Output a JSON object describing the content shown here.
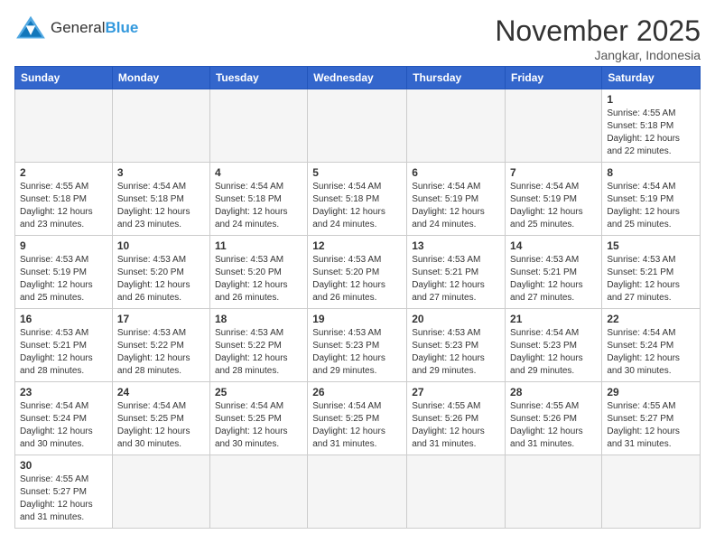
{
  "logo": {
    "text_general": "General",
    "text_blue": "Blue"
  },
  "title": "November 2025",
  "location": "Jangkar, Indonesia",
  "days_of_week": [
    "Sunday",
    "Monday",
    "Tuesday",
    "Wednesday",
    "Thursday",
    "Friday",
    "Saturday"
  ],
  "weeks": [
    [
      {
        "day": "",
        "info": ""
      },
      {
        "day": "",
        "info": ""
      },
      {
        "day": "",
        "info": ""
      },
      {
        "day": "",
        "info": ""
      },
      {
        "day": "",
        "info": ""
      },
      {
        "day": "",
        "info": ""
      },
      {
        "day": "1",
        "info": "Sunrise: 4:55 AM\nSunset: 5:18 PM\nDaylight: 12 hours and 22 minutes."
      }
    ],
    [
      {
        "day": "2",
        "info": "Sunrise: 4:55 AM\nSunset: 5:18 PM\nDaylight: 12 hours and 23 minutes."
      },
      {
        "day": "3",
        "info": "Sunrise: 4:54 AM\nSunset: 5:18 PM\nDaylight: 12 hours and 23 minutes."
      },
      {
        "day": "4",
        "info": "Sunrise: 4:54 AM\nSunset: 5:18 PM\nDaylight: 12 hours and 24 minutes."
      },
      {
        "day": "5",
        "info": "Sunrise: 4:54 AM\nSunset: 5:18 PM\nDaylight: 12 hours and 24 minutes."
      },
      {
        "day": "6",
        "info": "Sunrise: 4:54 AM\nSunset: 5:19 PM\nDaylight: 12 hours and 24 minutes."
      },
      {
        "day": "7",
        "info": "Sunrise: 4:54 AM\nSunset: 5:19 PM\nDaylight: 12 hours and 25 minutes."
      },
      {
        "day": "8",
        "info": "Sunrise: 4:54 AM\nSunset: 5:19 PM\nDaylight: 12 hours and 25 minutes."
      }
    ],
    [
      {
        "day": "9",
        "info": "Sunrise: 4:53 AM\nSunset: 5:19 PM\nDaylight: 12 hours and 25 minutes."
      },
      {
        "day": "10",
        "info": "Sunrise: 4:53 AM\nSunset: 5:20 PM\nDaylight: 12 hours and 26 minutes."
      },
      {
        "day": "11",
        "info": "Sunrise: 4:53 AM\nSunset: 5:20 PM\nDaylight: 12 hours and 26 minutes."
      },
      {
        "day": "12",
        "info": "Sunrise: 4:53 AM\nSunset: 5:20 PM\nDaylight: 12 hours and 26 minutes."
      },
      {
        "day": "13",
        "info": "Sunrise: 4:53 AM\nSunset: 5:21 PM\nDaylight: 12 hours and 27 minutes."
      },
      {
        "day": "14",
        "info": "Sunrise: 4:53 AM\nSunset: 5:21 PM\nDaylight: 12 hours and 27 minutes."
      },
      {
        "day": "15",
        "info": "Sunrise: 4:53 AM\nSunset: 5:21 PM\nDaylight: 12 hours and 27 minutes."
      }
    ],
    [
      {
        "day": "16",
        "info": "Sunrise: 4:53 AM\nSunset: 5:21 PM\nDaylight: 12 hours and 28 minutes."
      },
      {
        "day": "17",
        "info": "Sunrise: 4:53 AM\nSunset: 5:22 PM\nDaylight: 12 hours and 28 minutes."
      },
      {
        "day": "18",
        "info": "Sunrise: 4:53 AM\nSunset: 5:22 PM\nDaylight: 12 hours and 28 minutes."
      },
      {
        "day": "19",
        "info": "Sunrise: 4:53 AM\nSunset: 5:23 PM\nDaylight: 12 hours and 29 minutes."
      },
      {
        "day": "20",
        "info": "Sunrise: 4:53 AM\nSunset: 5:23 PM\nDaylight: 12 hours and 29 minutes."
      },
      {
        "day": "21",
        "info": "Sunrise: 4:54 AM\nSunset: 5:23 PM\nDaylight: 12 hours and 29 minutes."
      },
      {
        "day": "22",
        "info": "Sunrise: 4:54 AM\nSunset: 5:24 PM\nDaylight: 12 hours and 30 minutes."
      }
    ],
    [
      {
        "day": "23",
        "info": "Sunrise: 4:54 AM\nSunset: 5:24 PM\nDaylight: 12 hours and 30 minutes."
      },
      {
        "day": "24",
        "info": "Sunrise: 4:54 AM\nSunset: 5:25 PM\nDaylight: 12 hours and 30 minutes."
      },
      {
        "day": "25",
        "info": "Sunrise: 4:54 AM\nSunset: 5:25 PM\nDaylight: 12 hours and 30 minutes."
      },
      {
        "day": "26",
        "info": "Sunrise: 4:54 AM\nSunset: 5:25 PM\nDaylight: 12 hours and 31 minutes."
      },
      {
        "day": "27",
        "info": "Sunrise: 4:55 AM\nSunset: 5:26 PM\nDaylight: 12 hours and 31 minutes."
      },
      {
        "day": "28",
        "info": "Sunrise: 4:55 AM\nSunset: 5:26 PM\nDaylight: 12 hours and 31 minutes."
      },
      {
        "day": "29",
        "info": "Sunrise: 4:55 AM\nSunset: 5:27 PM\nDaylight: 12 hours and 31 minutes."
      }
    ],
    [
      {
        "day": "30",
        "info": "Sunrise: 4:55 AM\nSunset: 5:27 PM\nDaylight: 12 hours and 31 minutes."
      },
      {
        "day": "",
        "info": ""
      },
      {
        "day": "",
        "info": ""
      },
      {
        "day": "",
        "info": ""
      },
      {
        "day": "",
        "info": ""
      },
      {
        "day": "",
        "info": ""
      },
      {
        "day": "",
        "info": ""
      }
    ]
  ]
}
